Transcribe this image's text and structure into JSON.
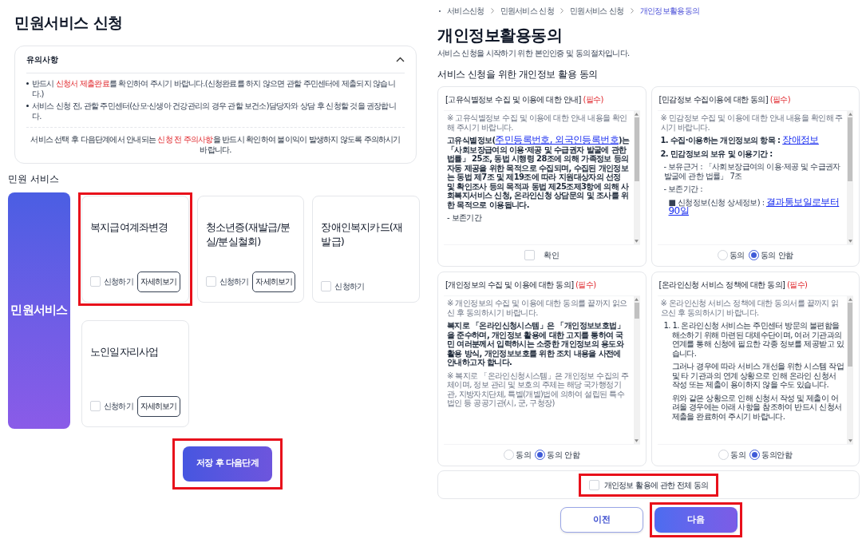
{
  "left": {
    "title": "민원서비스 신청",
    "notice": {
      "heading": "유의사항",
      "expanded": true,
      "bullets": [
        [
          {
            "text": "반드시 ",
            "kind": "plain"
          },
          {
            "text": "신청서 제출완료",
            "kind": "accent"
          },
          {
            "text": "를 확인하여 주시기 바랍니다.(신청완료를 하지 않으면 관할 주민센터에 제출되지 않습니다.)",
            "kind": "plain"
          }
        ],
        [
          {
            "text": "서비스 신청 전, 관할 주민센터(산모·신생아 건강관리의 경우 관할 보건소)담당자와 상담 후 신청할 것을 권장합니다.",
            "kind": "plain"
          }
        ]
      ],
      "footer": [
        {
          "text": "서비스 선택 후 다음단계에서 안내되는 ",
          "kind": "plain"
        },
        {
          "text": "신청 전 주의사항",
          "kind": "accent"
        },
        {
          "text": "을 반드시 확인하여 불이익이 발생하지 않도록 주의하시기 바랍니다.",
          "kind": "plain"
        }
      ]
    },
    "section_label": "민원 서비스",
    "category_tile": "민원서비스",
    "services": [
      {
        "title": "복지급여계좌변경",
        "apply_label": "신청하기",
        "checked": false,
        "detail_button": "자세히보기",
        "highlighted": true
      },
      {
        "title": "청소년증(재발급/분실/분실철회)",
        "apply_label": "신청하기",
        "checked": false,
        "detail_button": "자세히보기",
        "highlighted": false
      },
      {
        "title": "장애인복지카드(재발급)",
        "apply_label": "신청하기",
        "checked": false,
        "highlighted": false
      },
      {
        "title": "노인일자리사업",
        "apply_label": "신청하기",
        "checked": false,
        "detail_button": "자세히보기",
        "highlighted": false
      }
    ],
    "save_button": {
      "label": "저장 후 다음단계",
      "highlighted": true
    }
  },
  "right": {
    "breadcrumb": [
      {
        "label": "서비스신청",
        "selected": false
      },
      {
        "label": "민원서비스 신청",
        "selected": false
      },
      {
        "label": "민원서비스 신청",
        "selected": false
      },
      {
        "label": "개인정보활용동의",
        "selected": true
      }
    ],
    "title": "개인정보활용동의",
    "subtitle": "서비스 신청을 시작하기 위한 본인인증 및 동의절차입니다.",
    "section_heading": "서비스 신청을 위한 개인정보 활용 동의",
    "agreements": [
      {
        "title": "[고유식별정보 수집 및 이용에 대한 안내]",
        "required_tag": "(필수)",
        "kind": "checkbox",
        "paragraphs": [
          {
            "kind": "note",
            "segments": [
              {
                "text": "※ 고유식별정보 수집 및 이용에 대한 안내 내용을 확인해 주시기 바랍니다.",
                "kind": "plain"
              }
            ]
          },
          {
            "kind": "text",
            "segments": [
              {
                "text": "고유식별정보(",
                "kind": "bold"
              },
              {
                "text": "주민등록번호, 외국인등록번호",
                "kind": "link"
              },
              {
                "text": ")는 「사회보장급여의 이용·제공 및 수급권자 발굴에 관한 법률」 25조, 동법 시행령 28조에 의해 가족정보 등의 자동 제공을 위한 목적으로 수집되며, 수집된 개인정보는 동법 제7조 및 제19조에 따라 지원대상자의 선정 및 확인조사 등의 목적과 동법 제25조제3항에 의해 사회복지서비스 신청, 온라인신청 상담문의 및 조사를 위한 목적으로 이용됩니다.",
                "kind": "bold"
              }
            ]
          },
          {
            "kind": "text",
            "segments": [
              {
                "text": "- 보존기간",
                "kind": "plain"
              }
            ]
          }
        ],
        "confirm": {
          "label": "확인",
          "checked": false
        }
      },
      {
        "title": "[민감정보 수집이용에 대한 동의]",
        "required_tag": "(필수)",
        "kind": "radio",
        "paragraphs": [
          {
            "kind": "note",
            "segments": [
              {
                "text": "※ 민감정보 수집 및 이용에 대한 안내 내용을 확인해 주시기 바랍니다.",
                "kind": "plain"
              }
            ]
          },
          {
            "kind": "text",
            "segments": [
              {
                "text": "1. 수집·이용하는 개인정보의 항목 : ",
                "kind": "bold"
              },
              {
                "text": "장애정보",
                "kind": "link"
              }
            ]
          },
          {
            "kind": "text",
            "segments": [
              {
                "text": "2. 민감정보의 보유 및 이용기간 :",
                "kind": "bold"
              }
            ]
          },
          {
            "kind": "sub",
            "segments": [
              {
                "text": "- 보유근거 : 「사회보장급여의 이용·제공 및 수급권자 발굴에 관한 법률」 7조",
                "kind": "plain"
              }
            ]
          },
          {
            "kind": "sub",
            "segments": [
              {
                "text": "- 보존기간 :",
                "kind": "plain"
              }
            ]
          },
          {
            "kind": "subsub",
            "segments": [
              {
                "text": "■ 신청정보(신청 상세정보) : ",
                "kind": "plain"
              },
              {
                "text": "결과통보일로부터 90일",
                "kind": "link"
              }
            ]
          }
        ],
        "options": [
          {
            "label": "동의",
            "selected": false
          },
          {
            "label": "동의 안함",
            "selected": true
          }
        ]
      },
      {
        "title": "[개인정보의 수집 및 이용에 대한 동의]",
        "required_tag": "(필수)",
        "kind": "radio",
        "paragraphs": [
          {
            "kind": "note",
            "segments": [
              {
                "text": "※ 개인정보의 수집 및 이용에 대한 동의를 끝까지 읽으신 후 동의하시기 바랍니다.",
                "kind": "plain"
              }
            ]
          },
          {
            "kind": "text",
            "segments": [
              {
                "text": "복지로 「온라인신청시스템」은 「개인정보보호법」을 준수하며, 개인정보 활용에 대한 고지를 통하여 국민 여러분께서 입력하시는 소중한 개인정보의 용도와 활용 방식, 개인정보보호를 위한 조치 내용을 사전에 안내하고자 합니다.",
                "kind": "bold"
              }
            ]
          },
          {
            "kind": "note",
            "segments": [
              {
                "text": "※ 복지로 「온라인신청시스템」은 개인정보 수집의 주체이며, 정보 관리 및 보호의 주체는 해당 국가행정기관, 지방자치단체, 특별(개별)법에 의하여 설립된 특수법인 등 공공기관(시, 군, 구청장)",
                "kind": "plain"
              }
            ]
          }
        ],
        "options": [
          {
            "label": "동의",
            "selected": false
          },
          {
            "label": "동의 안함",
            "selected": true
          }
        ]
      },
      {
        "title": "[온라인신청 서비스 정책에 대한 동의]",
        "required_tag": "(필수)",
        "kind": "radio",
        "paragraphs": [
          {
            "kind": "note",
            "segments": [
              {
                "text": "※ 온라인신청 서비스 정책에 대한 동의서를 끝까지 읽으신 후 동의하시기 바랍니다.",
                "kind": "plain"
              }
            ]
          },
          {
            "kind": "item",
            "marker": "1.",
            "segments": [
              {
                "text": "1. 온라인신청 서비스는 주민센터 방문의 불편함을 해소하기 위해 마련된 대체수단이며, 여러 기관과의 연계를 통해 신청에 필요한 각종 정보를 제공받고 있습니다.",
                "kind": "plain"
              }
            ]
          },
          {
            "kind": "cont",
            "segments": [
              {
                "text": "그러나 경우에 따라 서비스 개선을 위한 시스템 작업 및 타 기관과의 연계 상황으로 인해 온라인 신청서 작성 또는 제출이 용이하지 않을 수도 있습니다.",
                "kind": "plain"
              }
            ]
          },
          {
            "kind": "cont",
            "segments": [
              {
                "text": "위와 같은 상황으로 인해 신청서 작성 및 제출이 어려울 경우에는 아래 사항을 참조하여 반드시 신청서 제출을 완료하여 주시기 바랍니다.",
                "kind": "plain"
              }
            ]
          }
        ],
        "options": [
          {
            "label": "동의",
            "selected": false
          },
          {
            "label": "동의안함",
            "selected": true
          }
        ]
      }
    ],
    "agree_all": {
      "label": "개인정보 활용에 관한 전체 동의",
      "checked": false,
      "highlighted": true
    },
    "buttons": [
      {
        "label": "이전",
        "kind": "secondary",
        "highlighted": false
      },
      {
        "label": "다음",
        "kind": "primary",
        "highlighted": true
      }
    ]
  }
}
